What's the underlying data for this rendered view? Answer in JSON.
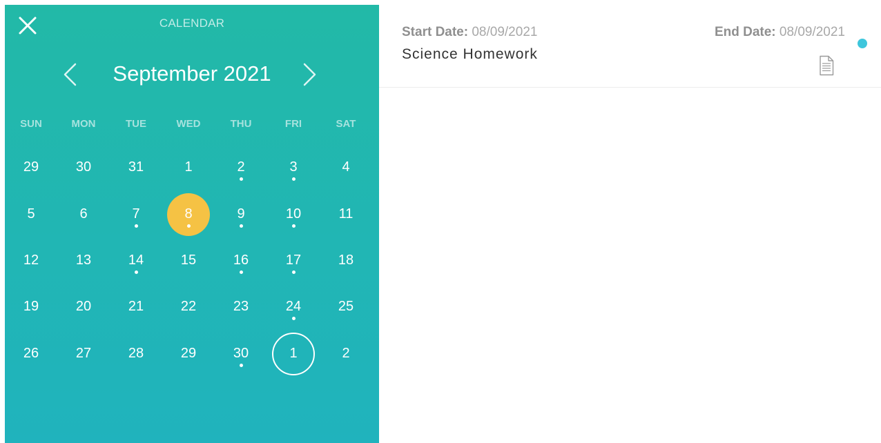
{
  "calendar": {
    "title": "CALENDAR",
    "month_label": "September 2021",
    "accent_color": "#22b6b0",
    "selected_color": "#f5c244",
    "close_icon": "close-icon",
    "prev_icon": "chevron-left-icon",
    "next_icon": "chevron-right-icon",
    "weekdays": [
      "SUN",
      "MON",
      "TUE",
      "WED",
      "THU",
      "FRI",
      "SAT"
    ],
    "weeks": [
      [
        {
          "label": "29",
          "dot": false
        },
        {
          "label": "30",
          "dot": false
        },
        {
          "label": "31",
          "dot": false
        },
        {
          "label": "1",
          "dot": false
        },
        {
          "label": "2",
          "dot": true
        },
        {
          "label": "3",
          "dot": true
        },
        {
          "label": "4",
          "dot": false
        }
      ],
      [
        {
          "label": "5",
          "dot": false
        },
        {
          "label": "6",
          "dot": false
        },
        {
          "label": "7",
          "dot": true
        },
        {
          "label": "8",
          "dot": true,
          "selected": true
        },
        {
          "label": "9",
          "dot": true
        },
        {
          "label": "10",
          "dot": true
        },
        {
          "label": "11",
          "dot": false
        }
      ],
      [
        {
          "label": "12",
          "dot": false
        },
        {
          "label": "13",
          "dot": false
        },
        {
          "label": "14",
          "dot": true
        },
        {
          "label": "15",
          "dot": false
        },
        {
          "label": "16",
          "dot": true
        },
        {
          "label": "17",
          "dot": true
        },
        {
          "label": "18",
          "dot": false
        }
      ],
      [
        {
          "label": "19",
          "dot": false
        },
        {
          "label": "20",
          "dot": false
        },
        {
          "label": "21",
          "dot": false
        },
        {
          "label": "22",
          "dot": false
        },
        {
          "label": "23",
          "dot": false
        },
        {
          "label": "24",
          "dot": true
        },
        {
          "label": "25",
          "dot": false
        }
      ],
      [
        {
          "label": "26",
          "dot": false
        },
        {
          "label": "27",
          "dot": false
        },
        {
          "label": "28",
          "dot": false
        },
        {
          "label": "29",
          "dot": false
        },
        {
          "label": "30",
          "dot": true
        },
        {
          "label": "1",
          "dot": false,
          "outlined": true
        },
        {
          "label": "2",
          "dot": false
        }
      ]
    ]
  },
  "event": {
    "start_label": "Start Date:",
    "start_value": "08/09/2021",
    "end_label": "End Date:",
    "end_value": "08/09/2021",
    "title": "Science Homework",
    "status_color": "#3ec6dc",
    "status_icon": "status-dot-icon",
    "attachment_icon": "document-icon"
  }
}
